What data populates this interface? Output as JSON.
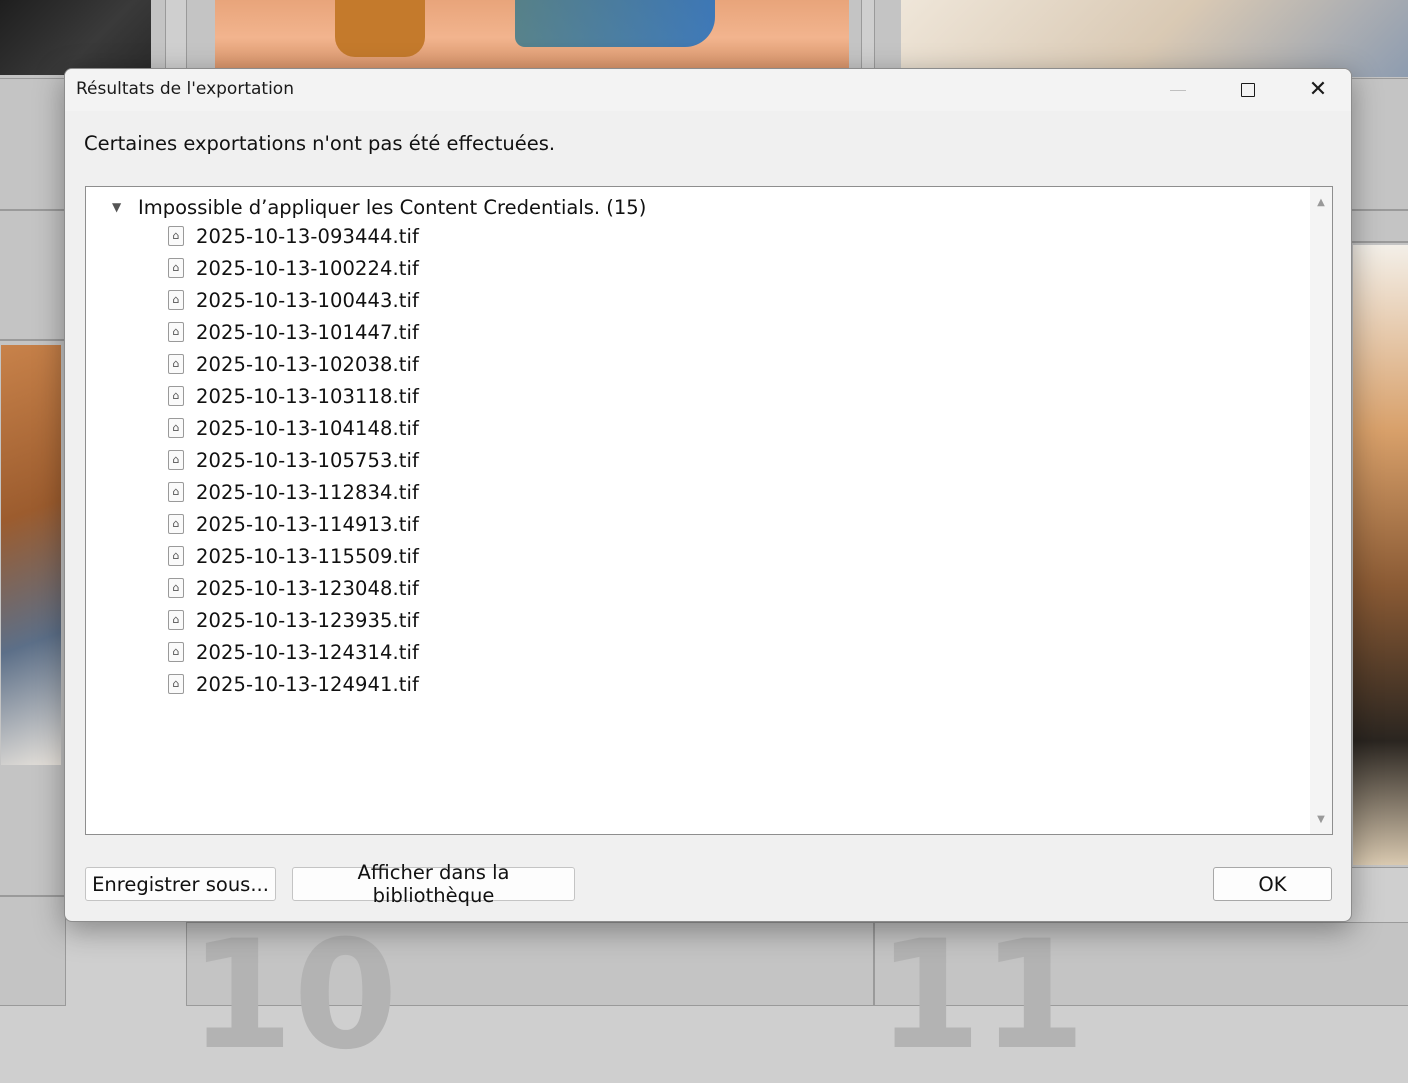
{
  "dialog": {
    "title": "Résultats de l'exportation",
    "message": "Certaines exportations n'ont pas été effectuées.",
    "group": {
      "label": "Impossible d’appliquer les Content Credentials. (15)",
      "files": [
        "2025-10-13-093444.tif",
        "2025-10-13-100224.tif",
        "2025-10-13-100443.tif",
        "2025-10-13-101447.tif",
        "2025-10-13-102038.tif",
        "2025-10-13-103118.tif",
        "2025-10-13-104148.tif",
        "2025-10-13-105753.tif",
        "2025-10-13-112834.tif",
        "2025-10-13-114913.tif",
        "2025-10-13-115509.tif",
        "2025-10-13-123048.tif",
        "2025-10-13-123935.tif",
        "2025-10-13-124314.tif",
        "2025-10-13-124941.tif"
      ]
    },
    "buttons": {
      "save_as": "Enregistrer sous...",
      "show_in_library": "Afficher dans la bibliothèque",
      "ok": "OK"
    }
  },
  "background": {
    "cell_numbers": [
      "10",
      "11"
    ]
  },
  "icons": {
    "window_controls": [
      "minimize-icon",
      "maximize-icon",
      "close-icon"
    ],
    "tree": "expand-caret-icon",
    "file": "file-icon"
  }
}
